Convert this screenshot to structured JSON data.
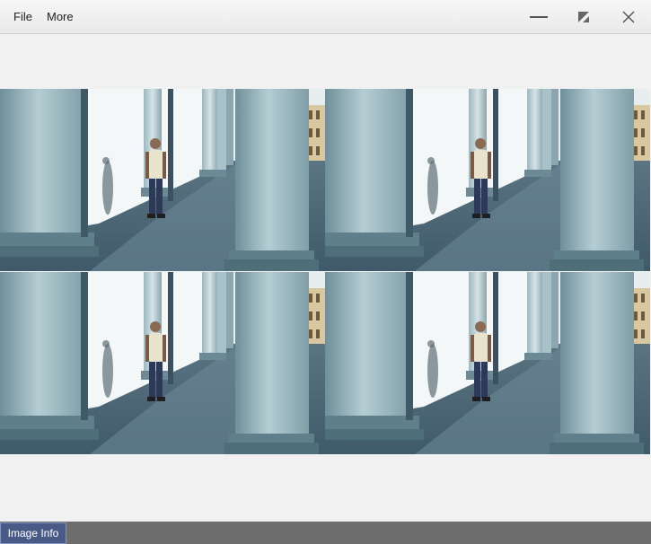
{
  "menu": {
    "file_label": "File",
    "more_label": "More"
  },
  "window_controls": {
    "minimize_icon": "minimize-icon",
    "maximize_icon": "maximize-icon",
    "close_icon": "close-icon"
  },
  "viewer": {
    "tiles": [
      {
        "name": "colonnade-image"
      },
      {
        "name": "colonnade-image"
      },
      {
        "name": "colonnade-image"
      },
      {
        "name": "colonnade-image"
      }
    ]
  },
  "statusbar": {
    "image_info_label": "Image Info"
  },
  "colors": {
    "statusbar_bg": "#6d6d6d",
    "button_bg": "#4a5a86",
    "content_bg": "#f1f1f1"
  }
}
